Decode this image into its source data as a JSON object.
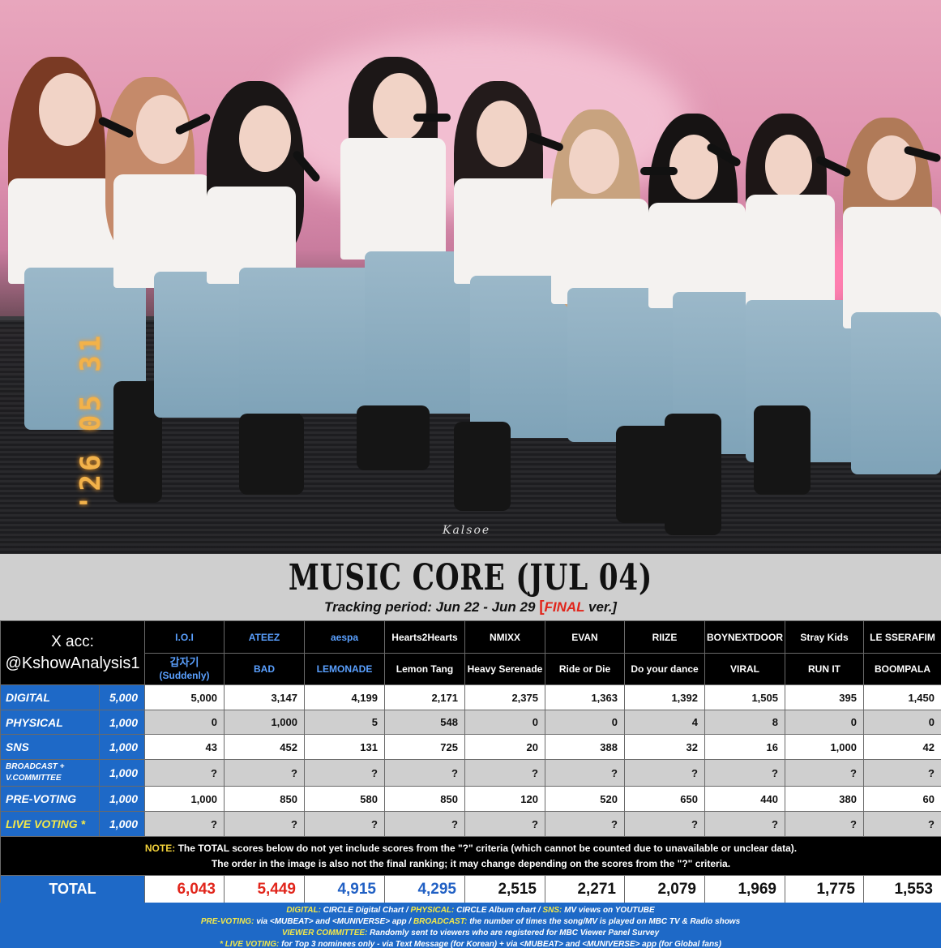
{
  "photo": {
    "date_stamp": "'26 05 31",
    "watermark": "Kalsoe"
  },
  "header": {
    "title": "MUSIC CORE (JUL 04)",
    "subtitle_prefix": "Tracking period: Jun 22 - Jun 29",
    "bracket_open": "[",
    "final_word": "FINAL",
    "subtitle_suffix": " ver.]"
  },
  "table": {
    "account_line1": "X acc:",
    "account_line2": "@KshowAnalysis1",
    "artists": [
      {
        "name": "I.O.I",
        "song": "갑자기 (Suddenly)",
        "highlight": true
      },
      {
        "name": "ATEEZ",
        "song": "BAD",
        "highlight": true
      },
      {
        "name": "aespa",
        "song": "LEMONADE",
        "highlight": true
      },
      {
        "name": "Hearts2Hearts",
        "song": "Lemon Tang",
        "highlight": false
      },
      {
        "name": "NMIXX",
        "song": "Heavy Serenade",
        "highlight": false
      },
      {
        "name": "EVAN",
        "song": "Ride or Die",
        "highlight": false
      },
      {
        "name": "RIIZE",
        "song": "Do your dance",
        "highlight": false
      },
      {
        "name": "BOYNEXTDOOR",
        "song": "VIRAL",
        "highlight": false
      },
      {
        "name": "Stray Kids",
        "song": "RUN IT",
        "highlight": false
      },
      {
        "name": "LE SSERAFIM",
        "song": "BOOMPALA",
        "highlight": false
      }
    ],
    "criteria": [
      {
        "label": "DIGITAL",
        "max": "5,000",
        "values": [
          "5,000",
          "3,147",
          "4,199",
          "2,171",
          "2,375",
          "1,363",
          "1,392",
          "1,505",
          "395",
          "1,450"
        ]
      },
      {
        "label": "PHYSICAL",
        "max": "1,000",
        "values": [
          "0",
          "1,000",
          "5",
          "548",
          "0",
          "0",
          "4",
          "8",
          "0",
          "0"
        ]
      },
      {
        "label": "SNS",
        "max": "1,000",
        "values": [
          "43",
          "452",
          "131",
          "725",
          "20",
          "388",
          "32",
          "16",
          "1,000",
          "42"
        ]
      },
      {
        "label": "BROADCAST + V.COMMITTEE",
        "max": "1,000",
        "values": [
          "?",
          "?",
          "?",
          "?",
          "?",
          "?",
          "?",
          "?",
          "?",
          "?"
        ]
      },
      {
        "label": "PRE-VOTING",
        "max": "1,000",
        "values": [
          "1,000",
          "850",
          "580",
          "850",
          "120",
          "520",
          "650",
          "440",
          "380",
          "60"
        ]
      },
      {
        "label": "LIVE VOTING *",
        "max": "1,000",
        "values": [
          "?",
          "?",
          "?",
          "?",
          "?",
          "?",
          "?",
          "?",
          "?",
          "?"
        ]
      }
    ],
    "note_label": "NOTE:",
    "note_line1": " The TOTAL scores below do not yet include scores from the \"?\" criteria (which cannot be counted due to unavailable or unclear data).",
    "note_line2": "The order in the image is also not the final ranking; it may change depending on the scores from the \"?\" criteria.",
    "total_label": "TOTAL",
    "totals": [
      "6,043",
      "5,449",
      "4,915",
      "4,295",
      "2,515",
      "2,271",
      "2,079",
      "1,969",
      "1,775",
      "1,553"
    ]
  },
  "footer": {
    "l1_k1": "DIGITAL:",
    "l1_v1": " CIRCLE Digital Chart / ",
    "l1_k2": "PHYSICAL:",
    "l1_v2": " CIRCLE Album chart / ",
    "l1_k3": "SNS:",
    "l1_v3": " MV views on YOUTUBE",
    "l2_k1": "PRE-VOTING:",
    "l2_v1": " via <MUBEAT> and <MUNIVERSE> app / ",
    "l2_k2": "BROADCAST:",
    "l2_v2": " the number of times the song/MV is played on MBC TV & Radio shows",
    "l3_k1": "VIEWER COMMITTEE:",
    "l3_v1": " Randomly sent to viewers who are registered for MBC Viewer Panel Survey",
    "l4_k1": "* LIVE VOTING:",
    "l4_v1": " for Top 3 nominees only - via Text Message (for Korean) + via <MUBEAT> and <MUNIVERSE> app (for Global fans)"
  },
  "colors": {
    "header_bg": "#cfcfcf",
    "criteria_bg": "#1e69c7",
    "total_red": "#e1251b",
    "total_blue": "#2160c4",
    "artist_blue": "#5aa0ff",
    "live_yellow": "#f3e84a"
  }
}
